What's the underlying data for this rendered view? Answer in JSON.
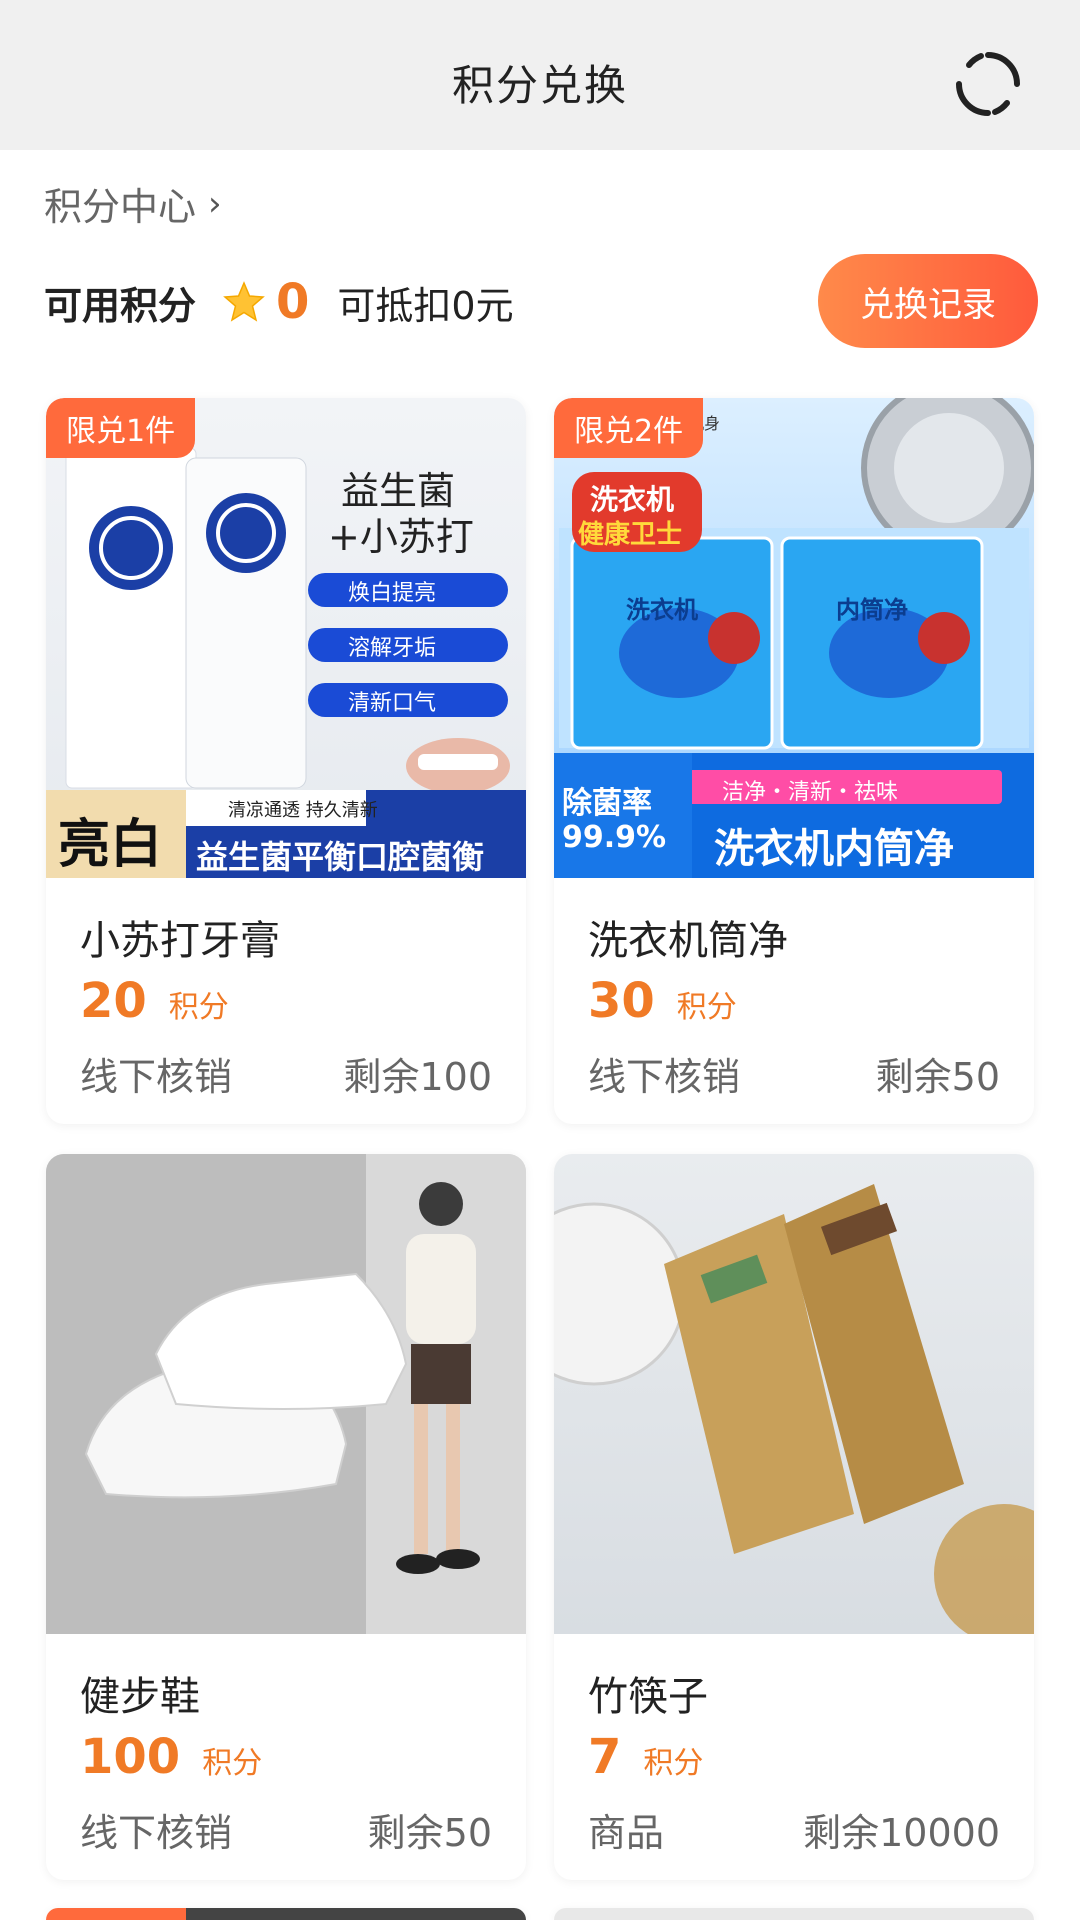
{
  "header": {
    "title": "积分兑换",
    "refresh_icon": "refresh-icon"
  },
  "breadcrumb": {
    "label": "积分中心",
    "chevron": "›"
  },
  "points": {
    "label": "可用积分",
    "icon": "star-icon",
    "value": "0",
    "deduct_text": "可抵扣0元",
    "history_button": "兑换记录"
  },
  "colors": {
    "accent": "#f07a26",
    "badge": "#ff6a3c",
    "button_gradient": [
      "#ff8a4a",
      "#ff5a3c"
    ]
  },
  "products": [
    {
      "badge": "限兑1件",
      "name": "小苏打牙膏",
      "price": "20",
      "unit": "积分",
      "method": "线下核销",
      "remaining": "剩余100",
      "image_text": {
        "headline1": "益生菌",
        "headline2": "+小苏打",
        "f1": "焕白提亮",
        "f2": "溶解牙垢",
        "f3": "清新口气",
        "strap_small": "清凉通透 持久清新",
        "strap_big": "亮白",
        "strap_main": "益生菌平衡口腔菌衡"
      }
    },
    {
      "badge": "限兑2件",
      "name": "洗衣机筒净",
      "price": "30",
      "unit": "积分",
      "method": "线下核销",
      "remaining": "剩余50",
      "image_text": {
        "corner_small": "机身",
        "tag_line1": "洗衣机",
        "tag_line2": "健康卫士",
        "pack_title_a": "洗衣机",
        "pack_title_b": "内筒净",
        "rate_label": "除菌率",
        "rate_value": "99.9%",
        "clean_strip": "洁净・清新・祛味",
        "bottom_text": "洗衣机内筒净"
      }
    },
    {
      "badge": "",
      "name": "健步鞋",
      "price": "100",
      "unit": "积分",
      "method": "线下核销",
      "remaining": "剩余50"
    },
    {
      "badge": "",
      "name": "竹筷子",
      "price": "7",
      "unit": "积分",
      "method": "商品",
      "remaining": "剩余10000"
    }
  ]
}
